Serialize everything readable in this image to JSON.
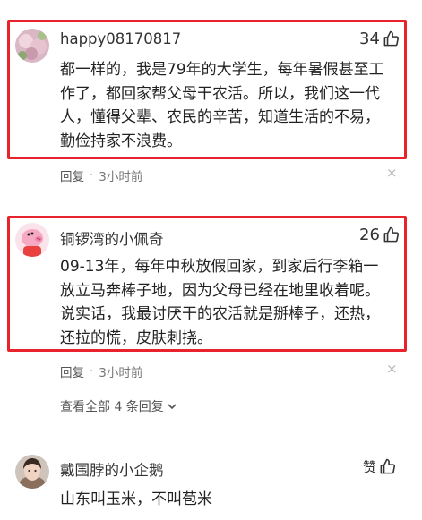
{
  "comments": [
    {
      "username": "happy08170817",
      "likes": "34",
      "lines": [
        "都一样的，我是79年的大学生，每年暑假甚至工",
        "作了，都回家帮父母干农活。所以，我们这一代",
        "人，懂得父辈、农民的辛苦，知道生活的不易，",
        "勤俭持家不浪费。"
      ],
      "reply": "回复",
      "dot": "·",
      "time": "3小时前",
      "close": "×"
    },
    {
      "username": "铜锣湾的小佩奇",
      "likes": "26",
      "lines": [
        "09-13年，每年中秋放假回家，到家后行李箱一",
        "放立马奔棒子地，因为父母已经在地里收着呢。",
        "说实话，我最讨厌干的农活就是掰棒子，还热，",
        "还拉的慌，皮肤刺挠。"
      ],
      "reply": "回复",
      "dot": "·",
      "time": "3小时前",
      "close": "×",
      "view_all": "查看全部 4 条回复"
    },
    {
      "username": "戴围脖的小企鹅",
      "likes": "赞",
      "lines": [
        "山东叫玉米，不叫苞米"
      ]
    }
  ],
  "colors": {
    "highlight_border": "#e8232b",
    "meta": "#777777"
  },
  "icons": {
    "like": "thumbs-up-icon",
    "close": "close-icon",
    "expand": "chevron-down-icon"
  }
}
